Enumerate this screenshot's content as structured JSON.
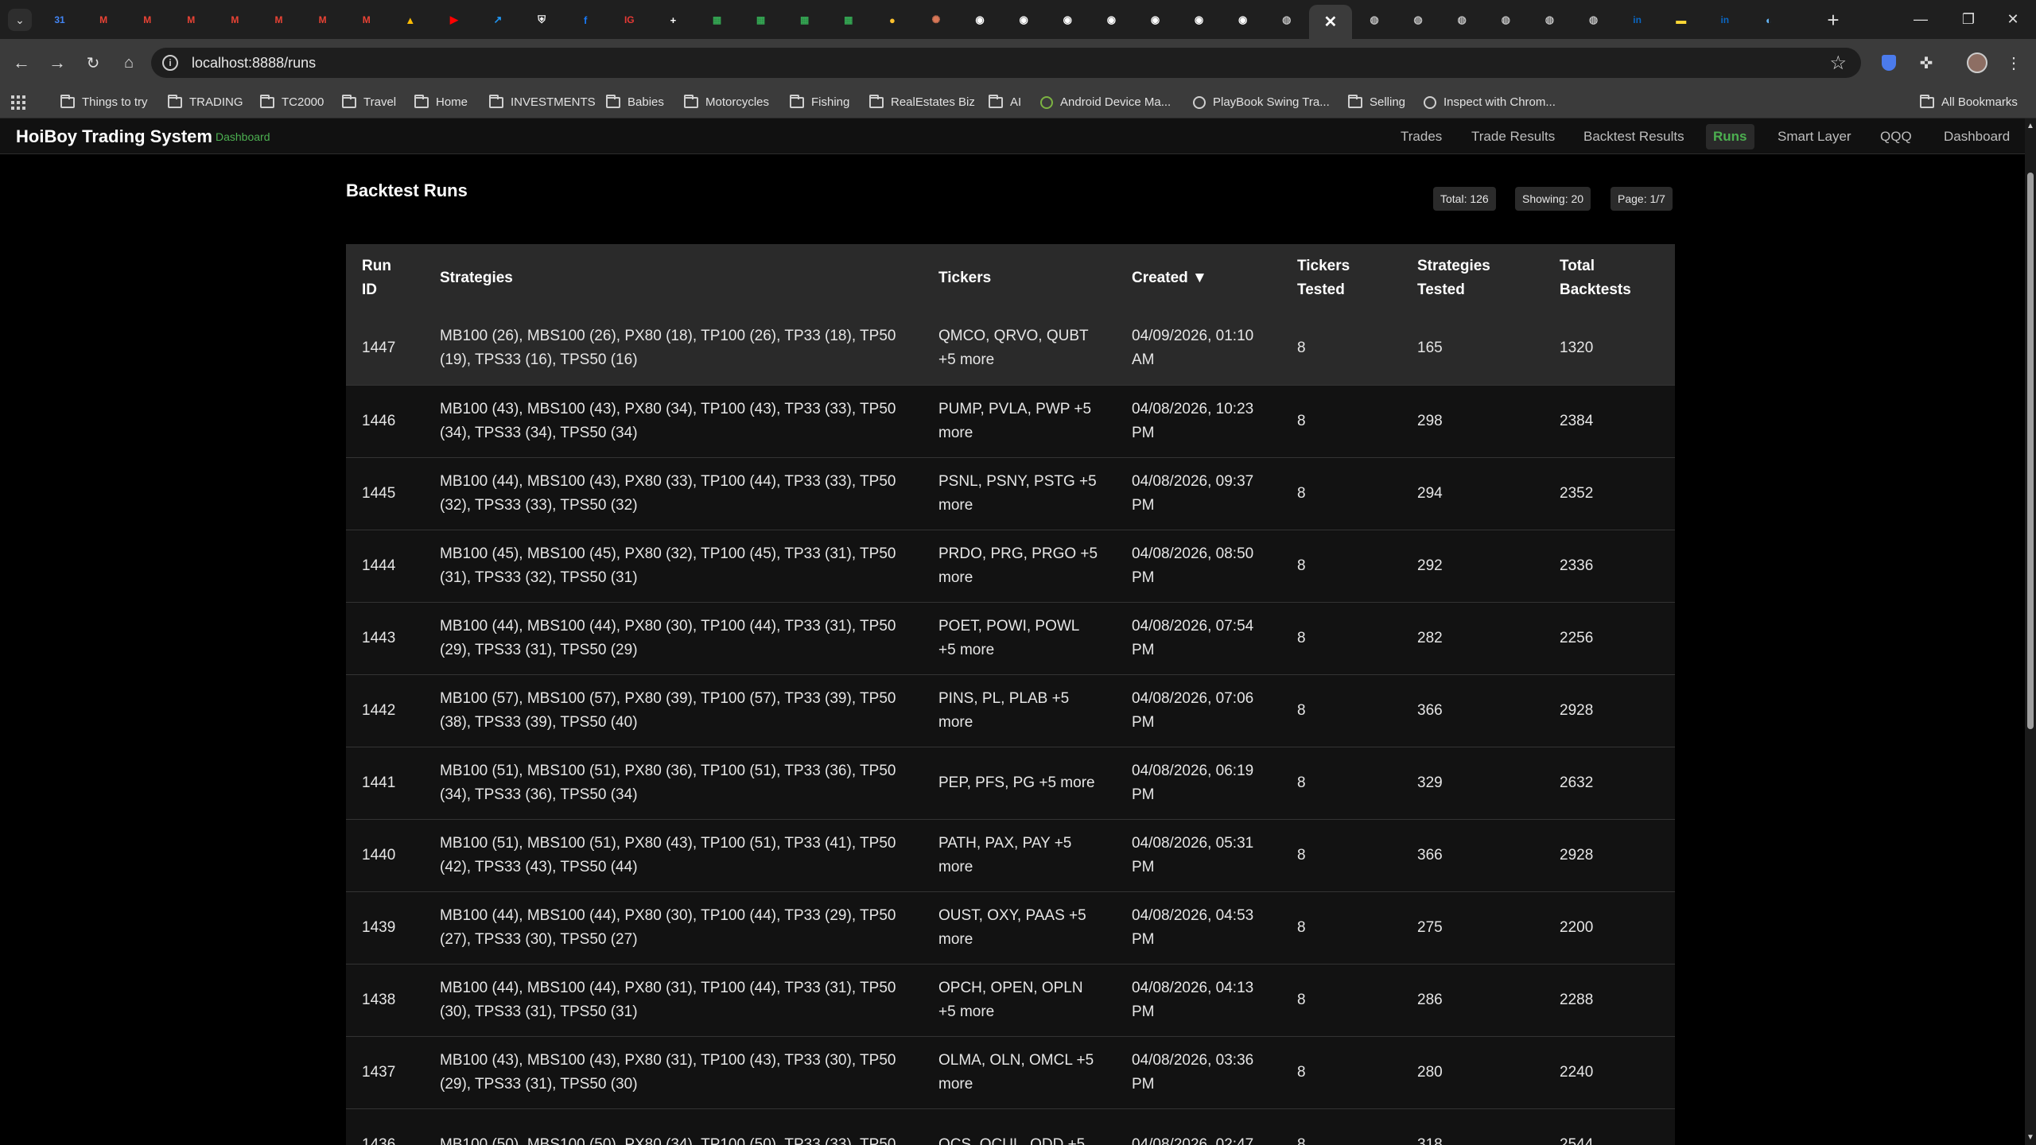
{
  "browser": {
    "url": "localhost:8888/runs",
    "tabs": [
      {
        "icon": "calendar-icon",
        "color": "#4285f4"
      },
      {
        "icon": "gmail-icon",
        "color": "#ea4335"
      },
      {
        "icon": "gmail-icon",
        "color": "#ea4335"
      },
      {
        "icon": "gmail-icon",
        "color": "#ea4335"
      },
      {
        "icon": "gmail-icon",
        "color": "#ea4335"
      },
      {
        "icon": "gmail-icon",
        "color": "#ea4335"
      },
      {
        "icon": "gmail-icon",
        "color": "#ea4335"
      },
      {
        "icon": "gmail-icon",
        "color": "#ea4335"
      },
      {
        "icon": "drive-icon",
        "color": "#fbbc04"
      },
      {
        "icon": "youtube-icon",
        "color": "#ff0000"
      },
      {
        "icon": "chart-icon",
        "color": "#2196f3"
      },
      {
        "icon": "shield-icon",
        "color": "#ffffff"
      },
      {
        "icon": "facebook-icon",
        "color": "#1877f2"
      },
      {
        "icon": "ig-icon",
        "color": "#e53935"
      },
      {
        "icon": "plus-doc-icon",
        "color": "#ffffff"
      },
      {
        "icon": "sheets-icon",
        "color": "#34a853"
      },
      {
        "icon": "sheets-icon",
        "color": "#34a853"
      },
      {
        "icon": "sheets-icon",
        "color": "#34a853"
      },
      {
        "icon": "sheets-icon",
        "color": "#34a853"
      },
      {
        "icon": "coin-icon",
        "color": "#fbc02d"
      },
      {
        "icon": "claude-icon",
        "color": "#d97757"
      },
      {
        "icon": "github-icon",
        "color": "#ffffff"
      },
      {
        "icon": "github-icon",
        "color": "#ffffff"
      },
      {
        "icon": "github-icon",
        "color": "#ffffff"
      },
      {
        "icon": "github-icon",
        "color": "#ffffff"
      },
      {
        "icon": "github-icon",
        "color": "#ffffff"
      },
      {
        "icon": "github-icon",
        "color": "#ffffff"
      },
      {
        "icon": "github-icon",
        "color": "#ffffff"
      },
      {
        "icon": "globe-icon",
        "color": "#bdbdbd"
      },
      {
        "icon": "close-icon",
        "color": "#ffffff",
        "active": true
      },
      {
        "icon": "globe-icon",
        "color": "#bdbdbd"
      },
      {
        "icon": "globe-icon",
        "color": "#bdbdbd"
      },
      {
        "icon": "globe-icon",
        "color": "#bdbdbd"
      },
      {
        "icon": "globe-icon",
        "color": "#bdbdbd"
      },
      {
        "icon": "globe-icon",
        "color": "#bdbdbd"
      },
      {
        "icon": "globe-icon",
        "color": "#bdbdbd"
      },
      {
        "icon": "linkedin-icon",
        "color": "#0a66c2"
      },
      {
        "icon": "flag-icon",
        "color": "#fdd835"
      },
      {
        "icon": "linkedin-icon",
        "color": "#0a66c2"
      },
      {
        "icon": "earth-icon",
        "color": "#64b5f6"
      }
    ],
    "bookmarks": [
      {
        "label": "Things to try",
        "icon": "folder-icon"
      },
      {
        "label": "TRADING",
        "icon": "folder-icon"
      },
      {
        "label": "TC2000",
        "icon": "folder-icon"
      },
      {
        "label": "Travel",
        "icon": "folder-icon"
      },
      {
        "label": "Home",
        "icon": "folder-icon"
      },
      {
        "label": "INVESTMENTS",
        "icon": "folder-icon"
      },
      {
        "label": "Babies",
        "icon": "folder-icon"
      },
      {
        "label": "Motorcycles",
        "icon": "folder-icon"
      },
      {
        "label": "Fishing",
        "icon": "folder-icon"
      },
      {
        "label": "RealEstates Biz",
        "icon": "folder-icon"
      },
      {
        "label": "AI",
        "icon": "folder-icon"
      },
      {
        "label": "Android Device Ma...",
        "icon": "android-icon"
      },
      {
        "label": "PlayBook Swing Tra...",
        "icon": "globe-icon"
      },
      {
        "label": "Selling",
        "icon": "folder-icon"
      },
      {
        "label": "Inspect with Chrom...",
        "icon": "globe-icon"
      }
    ],
    "all_bookmarks": "All Bookmarks"
  },
  "app": {
    "brand": "HoiBoy Trading System",
    "brand_sub": "Dashboard",
    "nav": [
      {
        "label": "Trades",
        "active": false
      },
      {
        "label": "Trade Results",
        "active": false
      },
      {
        "label": "Backtest Results",
        "active": false
      },
      {
        "label": "Runs",
        "active": true
      },
      {
        "label": "Smart Layer",
        "active": false
      },
      {
        "label": "QQQ",
        "active": false
      },
      {
        "label": "Dashboard",
        "active": false
      }
    ]
  },
  "runs": {
    "title": "Backtest Runs",
    "badges": {
      "total": "Total: 126",
      "showing": "Showing: 20",
      "page": "Page: 1/7"
    },
    "columns": [
      "Run ID",
      "Strategies",
      "Tickers",
      "Created ▼",
      "Tickers Tested",
      "Strategies Tested",
      "Total Backtests"
    ],
    "rows": [
      [
        "1447",
        "MB100 (26), MBS100 (26), PX80 (18), TP100 (26), TP33 (18), TP50 (19), TPS33 (16), TPS50 (16)",
        "QMCO, QRVO, QUBT +5 more",
        "04/09/2026, 01:10 AM",
        "8",
        "165",
        "1320"
      ],
      [
        "1446",
        "MB100 (43), MBS100 (43), PX80 (34), TP100 (43), TP33 (33), TP50 (34), TPS33 (34), TPS50 (34)",
        "PUMP, PVLA, PWP +5 more",
        "04/08/2026, 10:23 PM",
        "8",
        "298",
        "2384"
      ],
      [
        "1445",
        "MB100 (44), MBS100 (43), PX80 (33), TP100 (44), TP33 (33), TP50 (32), TPS33 (33), TPS50 (32)",
        "PSNL, PSNY, PSTG +5 more",
        "04/08/2026, 09:37 PM",
        "8",
        "294",
        "2352"
      ],
      [
        "1444",
        "MB100 (45), MBS100 (45), PX80 (32), TP100 (45), TP33 (31), TP50 (31), TPS33 (32), TPS50 (31)",
        "PRDO, PRG, PRGO +5 more",
        "04/08/2026, 08:50 PM",
        "8",
        "292",
        "2336"
      ],
      [
        "1443",
        "MB100 (44), MBS100 (44), PX80 (30), TP100 (44), TP33 (31), TP50 (29), TPS33 (31), TPS50 (29)",
        "POET, POWI, POWL +5 more",
        "04/08/2026, 07:54 PM",
        "8",
        "282",
        "2256"
      ],
      [
        "1442",
        "MB100 (57), MBS100 (57), PX80 (39), TP100 (57), TP33 (39), TP50 (38), TPS33 (39), TPS50 (40)",
        "PINS, PL, PLAB +5 more",
        "04/08/2026, 07:06 PM",
        "8",
        "366",
        "2928"
      ],
      [
        "1441",
        "MB100 (51), MBS100 (51), PX80 (36), TP100 (51), TP33 (36), TP50 (34), TPS33 (36), TPS50 (34)",
        "PEP, PFS, PG +5 more",
        "04/08/2026, 06:19 PM",
        "8",
        "329",
        "2632"
      ],
      [
        "1440",
        "MB100 (51), MBS100 (51), PX80 (43), TP100 (51), TP33 (41), TP50 (42), TPS33 (43), TPS50 (44)",
        "PATH, PAX, PAY +5 more",
        "04/08/2026, 05:31 PM",
        "8",
        "366",
        "2928"
      ],
      [
        "1439",
        "MB100 (44), MBS100 (44), PX80 (30), TP100 (44), TP33 (29), TP50 (27), TPS33 (30), TPS50 (27)",
        "OUST, OXY, PAAS +5 more",
        "04/08/2026, 04:53 PM",
        "8",
        "275",
        "2200"
      ],
      [
        "1438",
        "MB100 (44), MBS100 (44), PX80 (31), TP100 (44), TP33 (31), TP50 (30), TPS33 (31), TPS50 (31)",
        "OPCH, OPEN, OPLN +5 more",
        "04/08/2026, 04:13 PM",
        "8",
        "286",
        "2288"
      ],
      [
        "1437",
        "MB100 (43), MBS100 (43), PX80 (31), TP100 (43), TP33 (30), TP50 (29), TPS33 (31), TPS50 (30)",
        "OLMA, OLN, OMCL +5 more",
        "04/08/2026, 03:36 PM",
        "8",
        "280",
        "2240"
      ],
      [
        "1436",
        "MB100 (50), MBS100 (50), PX80 (34), TP100 (50), TP33 (33), TP50",
        "OCS, OCUL, ODD +5",
        "04/08/2026, 02:47",
        "8",
        "318",
        "2544"
      ]
    ]
  }
}
